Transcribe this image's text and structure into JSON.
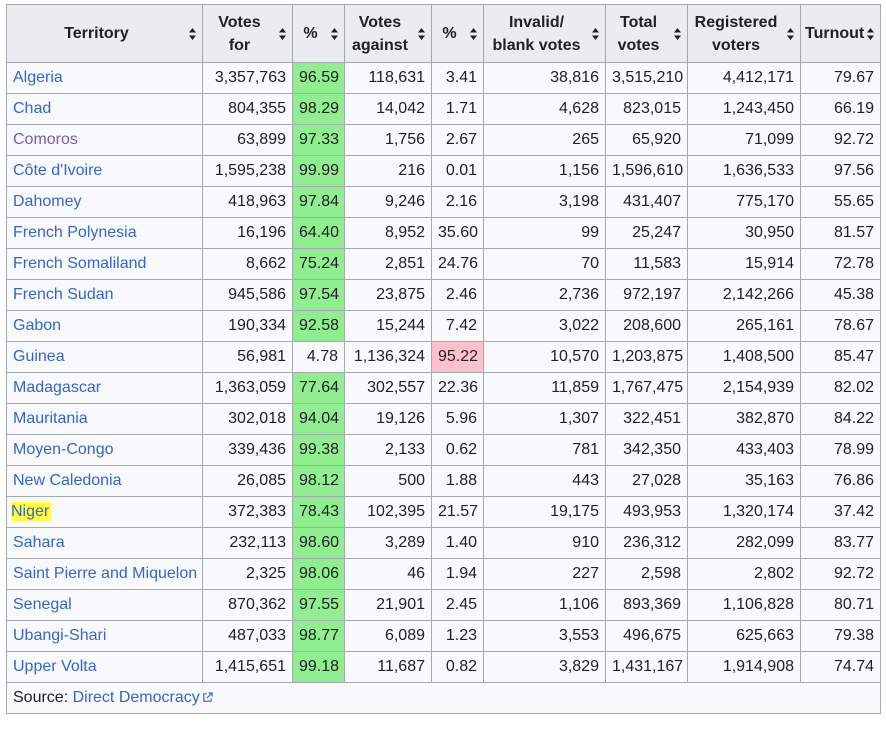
{
  "headers": [
    {
      "lines": [
        "Territory"
      ]
    },
    {
      "lines": [
        "Votes",
        "for"
      ]
    },
    {
      "lines": [
        "%"
      ]
    },
    {
      "lines": [
        "Votes",
        "against"
      ]
    },
    {
      "lines": [
        "%"
      ]
    },
    {
      "lines": [
        "Invalid/",
        "blank votes"
      ]
    },
    {
      "lines": [
        "Total",
        "votes"
      ]
    },
    {
      "lines": [
        "Registered",
        "voters"
      ]
    },
    {
      "lines": [
        "Turnout"
      ]
    }
  ],
  "rows": [
    {
      "territory": "Algeria",
      "votes_for": "3,357,763",
      "pct_for": "96.59",
      "votes_against": "118,631",
      "pct_against": "3.41",
      "invalid": "38,816",
      "total": "3,515,210",
      "registered": "4,412,171",
      "turnout": "79.67"
    },
    {
      "territory": "Chad",
      "votes_for": "804,355",
      "pct_for": "98.29",
      "votes_against": "14,042",
      "pct_against": "1.71",
      "invalid": "4,628",
      "total": "823,015",
      "registered": "1,243,450",
      "turnout": "66.19"
    },
    {
      "territory": "Comoros",
      "visited": true,
      "votes_for": "63,899",
      "pct_for": "97.33",
      "votes_against": "1,756",
      "pct_against": "2.67",
      "invalid": "265",
      "total": "65,920",
      "registered": "71,099",
      "turnout": "92.72"
    },
    {
      "territory": "Côte d'Ivoire",
      "votes_for": "1,595,238",
      "pct_for": "99.99",
      "votes_against": "216",
      "pct_against": "0.01",
      "invalid": "1,156",
      "total": "1,596,610",
      "registered": "1,636,533",
      "turnout": "97.56"
    },
    {
      "territory": "Dahomey",
      "votes_for": "418,963",
      "pct_for": "97.84",
      "votes_against": "9,246",
      "pct_against": "2.16",
      "invalid": "3,198",
      "total": "431,407",
      "registered": "775,170",
      "turnout": "55.65"
    },
    {
      "territory": "French Polynesia",
      "votes_for": "16,196",
      "pct_for": "64.40",
      "votes_against": "8,952",
      "pct_against": "35.60",
      "invalid": "99",
      "total": "25,247",
      "registered": "30,950",
      "turnout": "81.57"
    },
    {
      "territory": "French Somaliland",
      "votes_for": "8,662",
      "pct_for": "75.24",
      "votes_against": "2,851",
      "pct_against": "24.76",
      "invalid": "70",
      "total": "11,583",
      "registered": "15,914",
      "turnout": "72.78"
    },
    {
      "territory": "French Sudan",
      "votes_for": "945,586",
      "pct_for": "97.54",
      "votes_against": "23,875",
      "pct_against": "2.46",
      "invalid": "2,736",
      "total": "972,197",
      "registered": "2,142,266",
      "turnout": "45.38"
    },
    {
      "territory": "Gabon",
      "votes_for": "190,334",
      "pct_for": "92.58",
      "votes_against": "15,244",
      "pct_against": "7.42",
      "invalid": "3,022",
      "total": "208,600",
      "registered": "265,161",
      "turnout": "78.67"
    },
    {
      "territory": "Guinea",
      "votes_for": "56,981",
      "pct_for": "4.78",
      "votes_against": "1,136,324",
      "pct_against": "95.22",
      "invalid": "10,570",
      "total": "1,203,875",
      "registered": "1,408,500",
      "turnout": "85.47",
      "against_wins": true
    },
    {
      "territory": "Madagascar",
      "votes_for": "1,363,059",
      "pct_for": "77.64",
      "votes_against": "302,557",
      "pct_against": "22.36",
      "invalid": "11,859",
      "total": "1,767,475",
      "registered": "2,154,939",
      "turnout": "82.02"
    },
    {
      "territory": "Mauritania",
      "votes_for": "302,018",
      "pct_for": "94.04",
      "votes_against": "19,126",
      "pct_against": "5.96",
      "invalid": "1,307",
      "total": "322,451",
      "registered": "382,870",
      "turnout": "84.22"
    },
    {
      "territory": "Moyen-Congo",
      "votes_for": "339,436",
      "pct_for": "99.38",
      "votes_against": "2,133",
      "pct_against": "0.62",
      "invalid": "781",
      "total": "342,350",
      "registered": "433,403",
      "turnout": "78.99"
    },
    {
      "territory": "New Caledonia",
      "votes_for": "26,085",
      "pct_for": "98.12",
      "votes_against": "500",
      "pct_against": "1.88",
      "invalid": "443",
      "total": "27,028",
      "registered": "35,163",
      "turnout": "76.86"
    },
    {
      "territory": "Niger",
      "highlighted": true,
      "votes_for": "372,383",
      "pct_for": "78.43",
      "votes_against": "102,395",
      "pct_against": "21.57",
      "invalid": "19,175",
      "total": "493,953",
      "registered": "1,320,174",
      "turnout": "37.42"
    },
    {
      "territory": "Sahara",
      "votes_for": "232,113",
      "pct_for": "98.60",
      "votes_against": "3,289",
      "pct_against": "1.40",
      "invalid": "910",
      "total": "236,312",
      "registered": "282,099",
      "turnout": "83.77"
    },
    {
      "territory": "Saint Pierre and Miquelon",
      "votes_for": "2,325",
      "pct_for": "98.06",
      "votes_against": "46",
      "pct_against": "1.94",
      "invalid": "227",
      "total": "2,598",
      "registered": "2,802",
      "turnout": "92.72"
    },
    {
      "territory": "Senegal",
      "votes_for": "870,362",
      "pct_for": "97.55",
      "votes_against": "21,901",
      "pct_against": "2.45",
      "invalid": "1,106",
      "total": "893,369",
      "registered": "1,106,828",
      "turnout": "80.71"
    },
    {
      "territory": "Ubangi-Shari",
      "votes_for": "487,033",
      "pct_for": "98.77",
      "votes_against": "6,089",
      "pct_against": "1.23",
      "invalid": "3,553",
      "total": "496,675",
      "registered": "625,663",
      "turnout": "79.38"
    },
    {
      "territory": "Upper Volta",
      "votes_for": "1,415,651",
      "pct_for": "99.18",
      "votes_against": "11,687",
      "pct_against": "0.82",
      "invalid": "3,829",
      "total": "1,431,167",
      "registered": "1,914,908",
      "turnout": "74.74"
    }
  ],
  "source": {
    "label": "Source: ",
    "link_text": "Direct Democracy"
  },
  "colors": {
    "for_wins": "#90ee90",
    "against_wins": "#ffc0cb",
    "highlight": "#ffff44",
    "link": "#3366cc",
    "visited_link": "#795cb2",
    "header_bg": "#eaecf0",
    "cell_bg": "#f8f9fa",
    "border": "#a2a9b1"
  },
  "icons": {
    "sort": "sort-arrows-icon",
    "external_link": "external-link-icon"
  }
}
